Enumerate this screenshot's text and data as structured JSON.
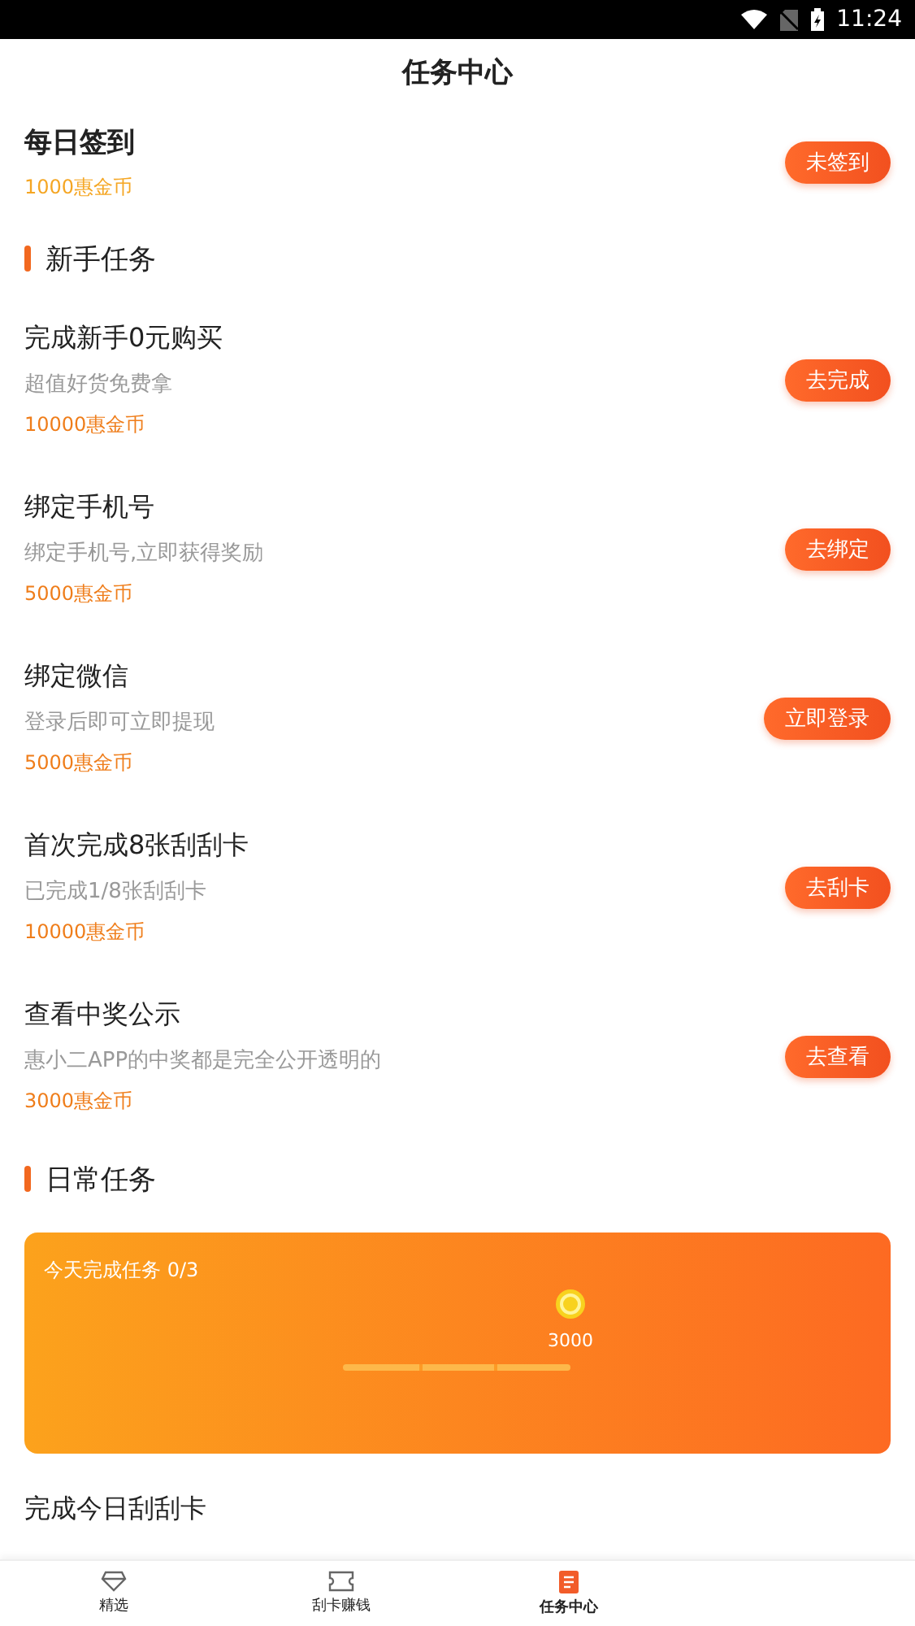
{
  "status_bar": {
    "time": "11:24"
  },
  "header": {
    "title": "任务中心"
  },
  "sign_in": {
    "title": "每日签到",
    "reward": "1000惠金币",
    "button": "未签到"
  },
  "newbie_section": {
    "title": "新手任务",
    "tasks": [
      {
        "title": "完成新手0元购买",
        "subtitle": "超值好货免费拿",
        "reward": "10000惠金币",
        "button": "去完成"
      },
      {
        "title": "绑定手机号",
        "subtitle": "绑定手机号,立即获得奖励",
        "reward": "5000惠金币",
        "button": "去绑定"
      },
      {
        "title": "绑定微信",
        "subtitle": "登录后即可立即提现",
        "reward": "5000惠金币",
        "button": "立即登录"
      },
      {
        "title": "首次完成8张刮刮卡",
        "subtitle": "已完成1/8张刮刮卡",
        "reward": "10000惠金币",
        "button": "去刮卡"
      },
      {
        "title": "查看中奖公示",
        "subtitle": "惠小二APP的中奖都是完全公开透明的",
        "reward": "3000惠金币",
        "button": "去查看"
      }
    ]
  },
  "daily_section": {
    "title": "日常任务",
    "progress_card": {
      "label": "今天完成任务 0/3",
      "reward": "3000"
    },
    "tasks": [
      {
        "title": "完成今日刮刮卡"
      }
    ]
  },
  "tab_bar": [
    {
      "label": "精选",
      "kind": "diamond",
      "selected": false
    },
    {
      "label": "刮卡赚钱",
      "kind": "ticket",
      "selected": false
    },
    {
      "label": "任务中心",
      "kind": "document",
      "selected": true
    }
  ]
}
